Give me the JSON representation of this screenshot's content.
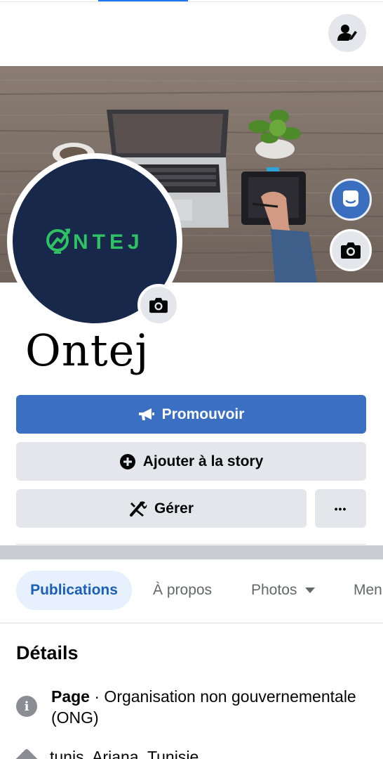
{
  "page": {
    "name": "Ontej",
    "logo_text": "NTEJ"
  },
  "buttons": {
    "promote": "Promouvoir",
    "add_story": "Ajouter à la story",
    "manage": "Gérer",
    "more": "•••"
  },
  "tabs": [
    {
      "label": "Publications",
      "active": true
    },
    {
      "label": "À propos",
      "active": false
    },
    {
      "label": "Photos",
      "active": false
    },
    {
      "label": "Men",
      "active": false
    }
  ],
  "details": {
    "title": "Détails",
    "category_label": "Page",
    "category_value": " · Organisation non gouvernementale (ONG)",
    "location": "tunis, Ariana, Tunisie"
  },
  "colors": {
    "primary": "#3b6fc2",
    "avatar_bg": "#17284a",
    "logo_green": "#2fc264",
    "active_tab_bg": "#e7f0fd"
  },
  "icons": {
    "edit_profile": "person-edit-icon",
    "messenger": "messenger-icon",
    "camera": "camera-icon",
    "megaphone": "megaphone-icon",
    "plus_circle": "plus-circle-icon",
    "tools": "tools-icon",
    "dropdown": "caret-down-icon",
    "info": "info-icon",
    "location": "location-icon"
  }
}
